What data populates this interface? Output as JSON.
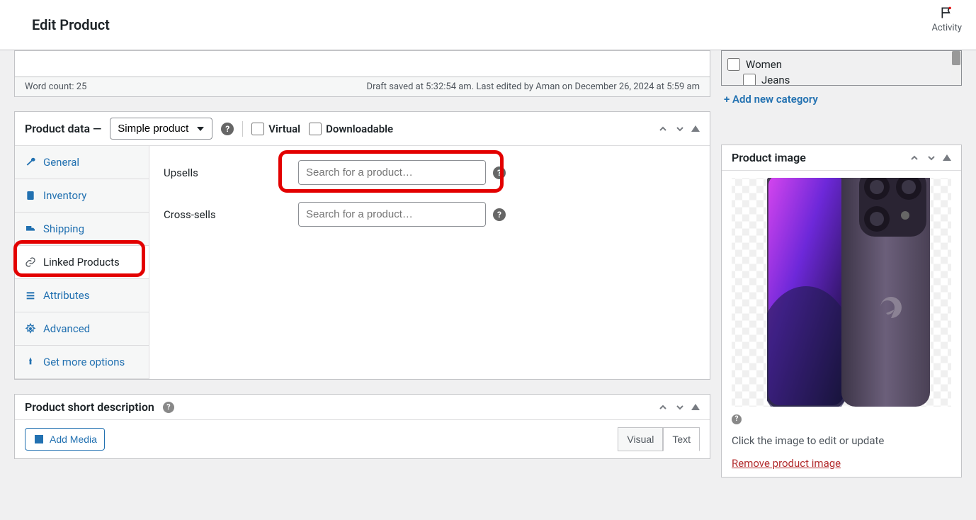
{
  "header": {
    "title": "Edit Product",
    "activity": "Activity"
  },
  "editor_footer": {
    "word_count": "Word count: 25",
    "status": "Draft saved at 5:32:54 am. Last edited by Aman on December 26, 2024 at 5:59 am"
  },
  "product_data": {
    "title": "Product data —",
    "type_value": "Simple product",
    "virtual": "Virtual",
    "downloadable": "Downloadable",
    "tabs": {
      "general": "General",
      "inventory": "Inventory",
      "shipping": "Shipping",
      "linked": "Linked Products",
      "attributes": "Attributes",
      "advanced": "Advanced",
      "getmore": "Get more options"
    },
    "upsells_label": "Upsells",
    "cross_label": "Cross-sells",
    "search_placeholder": "Search for a product…"
  },
  "short_desc": {
    "title": "Product short description",
    "add_media": "Add Media",
    "visual": "Visual",
    "text": "Text"
  },
  "categories": {
    "women": "Women",
    "jeans": "Jeans",
    "add_new": "+ Add new category"
  },
  "product_image": {
    "title": "Product image",
    "note": "Click the image to edit or update",
    "remove": "Remove product image"
  }
}
